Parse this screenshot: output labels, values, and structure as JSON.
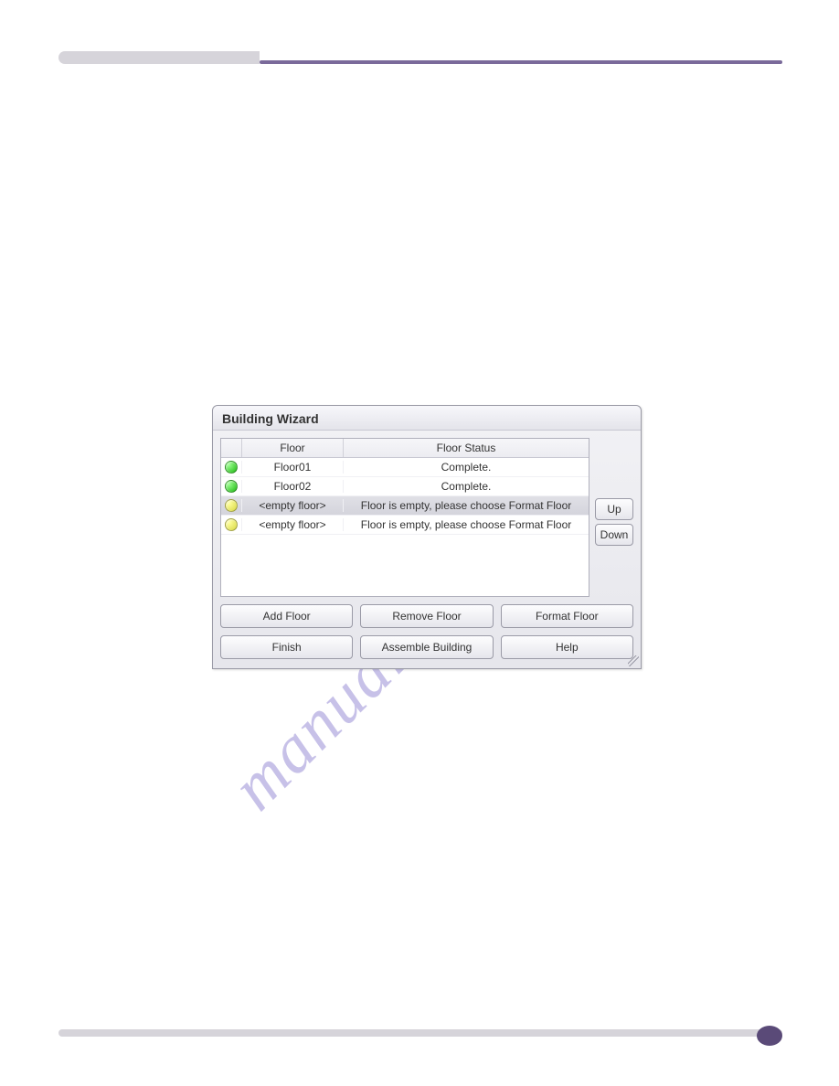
{
  "watermark": "manualshive.com",
  "dialog": {
    "title": "Building Wizard",
    "headers": {
      "floor": "Floor",
      "status": "Floor Status"
    },
    "rows": [
      {
        "color": "green",
        "floor": "Floor01",
        "status": "Complete.",
        "selected": false
      },
      {
        "color": "green",
        "floor": "Floor02",
        "status": "Complete.",
        "selected": false
      },
      {
        "color": "yellow",
        "floor": "<empty floor>",
        "status": "Floor is empty, please choose Format Floor",
        "selected": true
      },
      {
        "color": "yellow",
        "floor": "<empty floor>",
        "status": "Floor is empty, please choose Format Floor",
        "selected": false
      }
    ],
    "buttons": {
      "up": "Up",
      "down": "Down",
      "addFloor": "Add Floor",
      "removeFloor": "Remove Floor",
      "formatFloor": "Format Floor",
      "finish": "Finish",
      "assembleBuilding": "Assemble Building",
      "help": "Help"
    }
  }
}
